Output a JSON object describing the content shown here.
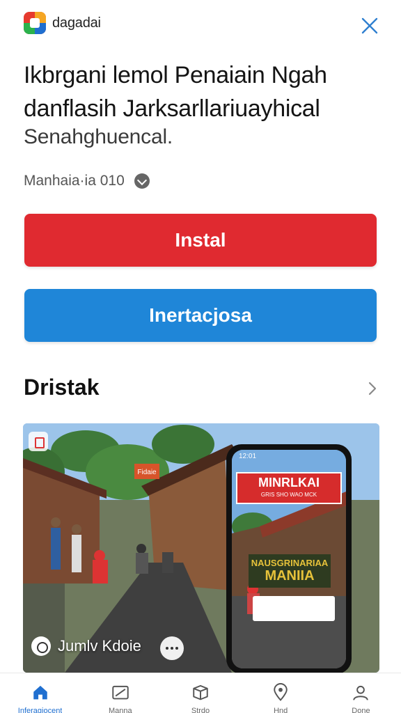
{
  "header": {
    "brand_name": "dagadai",
    "logo_colors": [
      "#e63a2e",
      "#f5a623",
      "#2bb24c",
      "#1f6fd0"
    ]
  },
  "app": {
    "title_line1": "Ikbrgani lemol Penaiain Ngah",
    "title_line2": "danflasih  Jarksarllariuayhical",
    "subtitle": "Senahghuencal.",
    "meta_text": "Manhaia·ia 010"
  },
  "actions": {
    "install_label": "Instal",
    "secondary_label": "Inertacjosa"
  },
  "section": {
    "title": "Dristak"
  },
  "media": {
    "label": "Jumlv Kdoie",
    "phone_status": "12:01",
    "phone_banner": "MINRLKAI",
    "phone_banner_small": "GRIS SHO WAO MCK",
    "phone_sign_top": "NAUSGRINARIAA",
    "phone_sign_main": "MANIIA",
    "street_banner": "Fidaie"
  },
  "nav": {
    "items": [
      {
        "label": "Inferagiocent",
        "icon": "home-icon"
      },
      {
        "label": "Manna",
        "icon": "card-icon"
      },
      {
        "label": "Strdo",
        "icon": "box-icon"
      },
      {
        "label": "Hnd",
        "icon": "map-pin-icon"
      },
      {
        "label": "Done",
        "icon": "profile-icon"
      }
    ]
  },
  "colors": {
    "install": "#e02a30",
    "secondary": "#1f86d8",
    "nav_active": "#1f6fd0"
  }
}
